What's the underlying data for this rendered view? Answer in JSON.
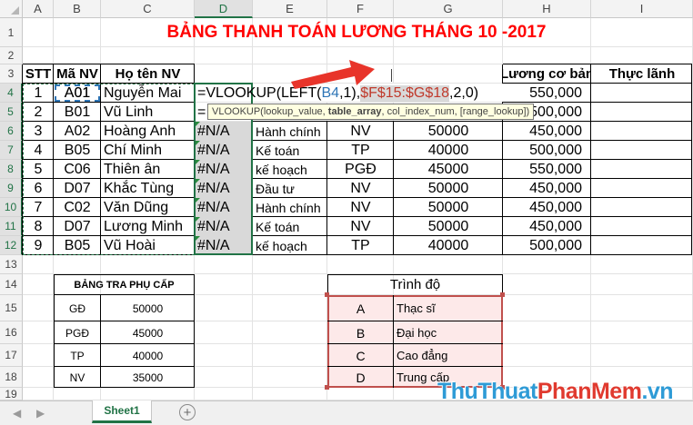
{
  "columns": [
    "A",
    "B",
    "C",
    "D",
    "E",
    "F",
    "G",
    "H",
    "I"
  ],
  "rows": [
    "1",
    "2",
    "3",
    "4",
    "5",
    "6",
    "7",
    "8",
    "9",
    "10",
    "11",
    "12",
    "13",
    "14",
    "15",
    "16",
    "17",
    "18",
    "19"
  ],
  "title": "BẢNG THANH TOÁN LƯƠNG THÁNG 10 -2017",
  "headers": {
    "stt": "STT",
    "ma_nv": "Mã NV",
    "ho_ten": "Họ tên NV",
    "luong": "Lương cơ bản",
    "thuc_linh": "Thực lãnh"
  },
  "employees": [
    {
      "stt": "1",
      "ma": "A01",
      "ten": "Nguyễn Mai",
      "d": "",
      "e": "",
      "f": "",
      "g": "",
      "h": "550,000"
    },
    {
      "stt": "2",
      "ma": "B01",
      "ten": "Vũ Linh",
      "d": "",
      "e": "",
      "f": "",
      "g": "",
      "h": "500,000"
    },
    {
      "stt": "3",
      "ma": "A02",
      "ten": "Hoàng Anh",
      "d": "#N/A",
      "e": "Hành chính",
      "f": "NV",
      "g": "50000",
      "h": "450,000"
    },
    {
      "stt": "4",
      "ma": "B05",
      "ten": "Chí Minh",
      "d": "#N/A",
      "e": "Kế toán",
      "f": "TP",
      "g": "40000",
      "h": "500,000"
    },
    {
      "stt": "5",
      "ma": "C06",
      "ten": "Thiên ân",
      "d": "#N/A",
      "e": "kế hoạch",
      "f": "PGĐ",
      "g": "45000",
      "h": "550,000"
    },
    {
      "stt": "6",
      "ma": "D07",
      "ten": "Khắc Tùng",
      "d": "#N/A",
      "e": "Đầu tư",
      "f": "NV",
      "g": "50000",
      "h": "450,000"
    },
    {
      "stt": "7",
      "ma": "C02",
      "ten": "Văn Dũng",
      "d": "#N/A",
      "e": "Hành chính",
      "f": "NV",
      "g": "50000",
      "h": "450,000"
    },
    {
      "stt": "8",
      "ma": "D07",
      "ten": "Lương Minh",
      "d": "#N/A",
      "e": "Kế toán",
      "f": "NV",
      "g": "50000",
      "h": "450,000"
    },
    {
      "stt": "9",
      "ma": "B05",
      "ten": "Vũ Hoài",
      "d": "#N/A",
      "e": "kế hoạch",
      "f": "TP",
      "g": "40000",
      "h": "500,000"
    }
  ],
  "formula": {
    "p1": "=VLOOKUP(LEFT(",
    "p2": "B4",
    "p3": ",1),",
    "p4": "$F$15:$G$18",
    "p5": ",2,0)",
    "row5_stub": "=",
    "tooltip": {
      "t1": "VLOOKUP(lookup_value, ",
      "t2": "table_array",
      "t3": ", col_index_num, [range_lookup])"
    }
  },
  "allowance_table": {
    "title": "BẢNG TRA PHỤ CẤP",
    "rows": [
      {
        "k": "GĐ",
        "v": "50000"
      },
      {
        "k": "PGĐ",
        "v": "45000"
      },
      {
        "k": "TP",
        "v": "40000"
      },
      {
        "k": "NV",
        "v": "35000"
      }
    ]
  },
  "level_table": {
    "title": "Trình độ",
    "rows": [
      {
        "k": "A",
        "v": "Thạc sĩ"
      },
      {
        "k": "B",
        "v": "Đại học"
      },
      {
        "k": "C",
        "v": "Cao đẳng"
      },
      {
        "k": "D",
        "v": "Trung cấp"
      }
    ]
  },
  "sheet_tab": "Sheet1",
  "watermark": "ThuThuatPhanMem.vn",
  "colors": {
    "title_red": "#ff0000",
    "excel_green": "#217346",
    "ref_blue": "#2e75b6",
    "ref_red": "#c0392b",
    "level_border": "#c0504d",
    "level_fill": "#fde9e9"
  }
}
